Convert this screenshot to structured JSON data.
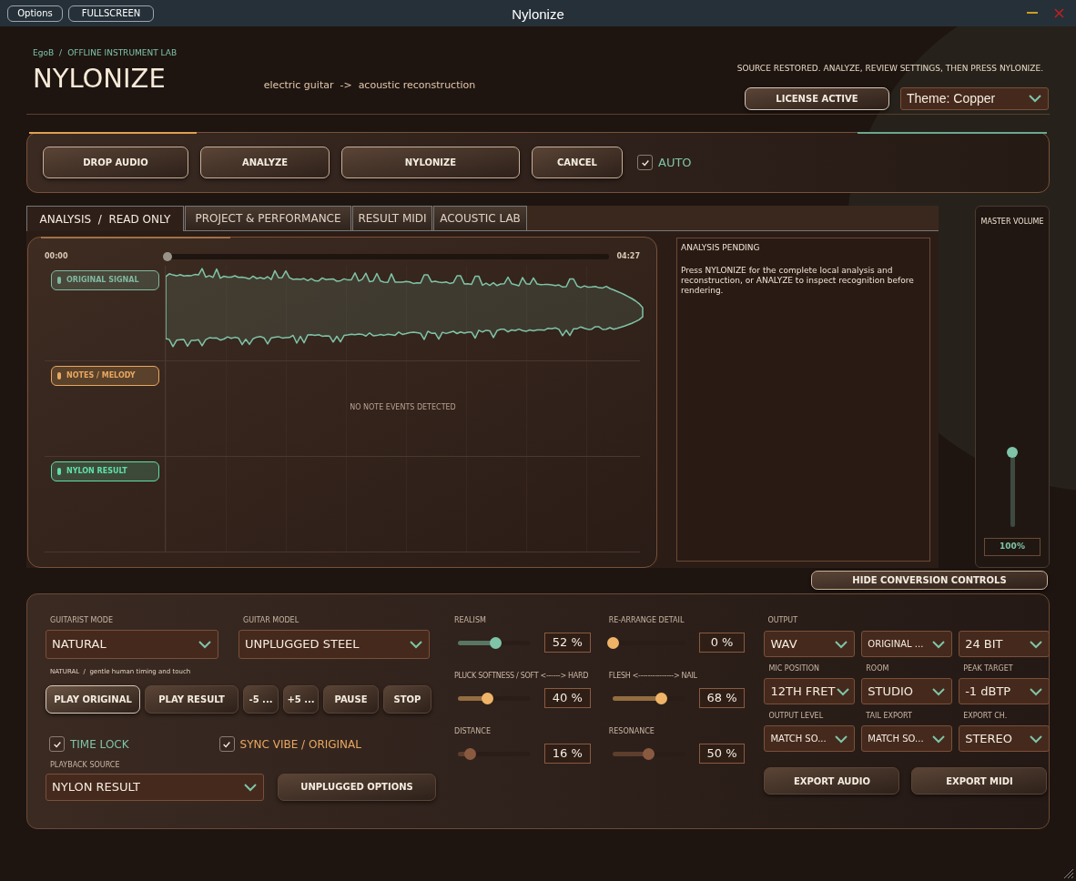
{
  "window": {
    "title": "Nylonize",
    "buttons": [
      "Options",
      "FULLSCREEN"
    ]
  },
  "header": {
    "breadcrumb": [
      "EgoB",
      "/",
      "OFFLINE INSTRUMENT LAB"
    ],
    "title": "NYLONIZE",
    "subtitle": "electric guitar  ->  acoustic reconstruction",
    "status": "SOURCE RESTORED. ANALYZE, REVIEW SETTINGS, THEN PRESS NYLONIZE.",
    "license_button": "LICENSE ACTIVE",
    "theme": {
      "value": "Theme: Copper"
    }
  },
  "toolbar": {
    "buttons": [
      "DROP AUDIO",
      "ANALYZE",
      "NYLONIZE",
      "CANCEL"
    ],
    "auto": {
      "label": "AUTO",
      "checked": true
    }
  },
  "tabs": [
    {
      "label": "ANALYSIS  /  READ ONLY",
      "selected": true
    },
    {
      "label": "PROJECT & PERFORMANCE",
      "selected": false
    },
    {
      "label": "RESULT MIDI",
      "selected": false
    },
    {
      "label": "ACOUSTIC LAB",
      "selected": false
    }
  ],
  "analysis": {
    "start_time": "00:00",
    "end_time": "04:27",
    "position": {
      "level": 0
    },
    "lanes": [
      {
        "label": "ORIGINAL SIGNAL",
        "color": "#7fb8a0",
        "kind": "waveform"
      },
      {
        "label": "NOTES / MELODY",
        "color": "#e8a860",
        "kind": "notes",
        "message": "NO NOTE EVENTS DETECTED"
      },
      {
        "label": "NYLON RESULT",
        "color": "#5ee0a8",
        "kind": "empty"
      }
    ]
  },
  "info": {
    "title": "ANALYSIS PENDING",
    "text": "Press NYLONIZE for the complete local analysis and reconstruction, or ANALYZE to inspect recognition before rendering."
  },
  "master_volume": {
    "label": "MASTER VOLUME",
    "level": 1,
    "reading": "100%"
  },
  "hide_button": "HIDE CONVERSION CONTROLS",
  "controls": {
    "guitarist_mode": {
      "label": "GUITARIST MODE",
      "value": "NATURAL"
    },
    "guitar_model": {
      "label": "GUITAR MODEL",
      "value": "UNPLUGGED STEEL"
    },
    "mode_hint": "NATURAL  /  gentle human timing and touch",
    "transport": [
      {
        "label": "PLAY ORIGINAL",
        "selected": true
      },
      {
        "label": "PLAY RESULT",
        "selected": false
      },
      {
        "label": "-5 ...",
        "selected": false
      },
      {
        "label": "+5 ...",
        "selected": false
      },
      {
        "label": "PAUSE",
        "selected": false
      },
      {
        "label": "STOP",
        "selected": false
      }
    ],
    "checkboxes": [
      {
        "label": "TIME LOCK",
        "checked": true,
        "color": "#7fc4a8"
      },
      {
        "label": "SYNC VIBE / ORIGINAL",
        "checked": true,
        "color": "#e8a860"
      }
    ],
    "playback_source": {
      "label": "PLAYBACK SOURCE",
      "value": "NYLON RESULT"
    },
    "unplugged_button": "UNPLUGGED OPTIONS",
    "sliders": [
      {
        "label": "REALISM",
        "level": 0.52,
        "reading": "52 %",
        "color": "#7fc4a8"
      },
      {
        "label": "RE-ARRANGE DETAIL",
        "level": 0,
        "reading": "0 %",
        "color": "#f0b468"
      },
      {
        "label": "PLUCK SOFTNESS  /  SOFT <------> HARD",
        "level": 0.4,
        "reading": "40 %",
        "color": "#f0b468"
      },
      {
        "label": "FLESH   <--------------->   NAIL",
        "level": 0.68,
        "reading": "68 %",
        "color": "#f0b468"
      },
      {
        "label": "DISTANCE",
        "level": 0.16,
        "reading": "16 %",
        "color": "#8a5a40"
      },
      {
        "label": "RESONANCE",
        "level": 0.5,
        "reading": "50 %",
        "color": "#8a5a40"
      }
    ],
    "output_label": "OUTPUT",
    "output_fields": [
      {
        "value": "WAV"
      },
      {
        "value": "ORIGINAL ..."
      },
      {
        "value": "24 BIT"
      },
      {
        "label": "MIC POSITION",
        "value": "12TH FRET"
      },
      {
        "label": "ROOM",
        "value": "STUDIO"
      },
      {
        "label": "PEAK TARGET",
        "value": "-1 dBTP"
      },
      {
        "label": "OUTPUT LEVEL",
        "value": "MATCH SO..."
      },
      {
        "label": "TAIL EXPORT",
        "value": "MATCH SO..."
      },
      {
        "label": "EXPORT CH.",
        "value": "STEREO"
      }
    ],
    "export_buttons": [
      "EXPORT AUDIO",
      "EXPORT MIDI"
    ]
  }
}
